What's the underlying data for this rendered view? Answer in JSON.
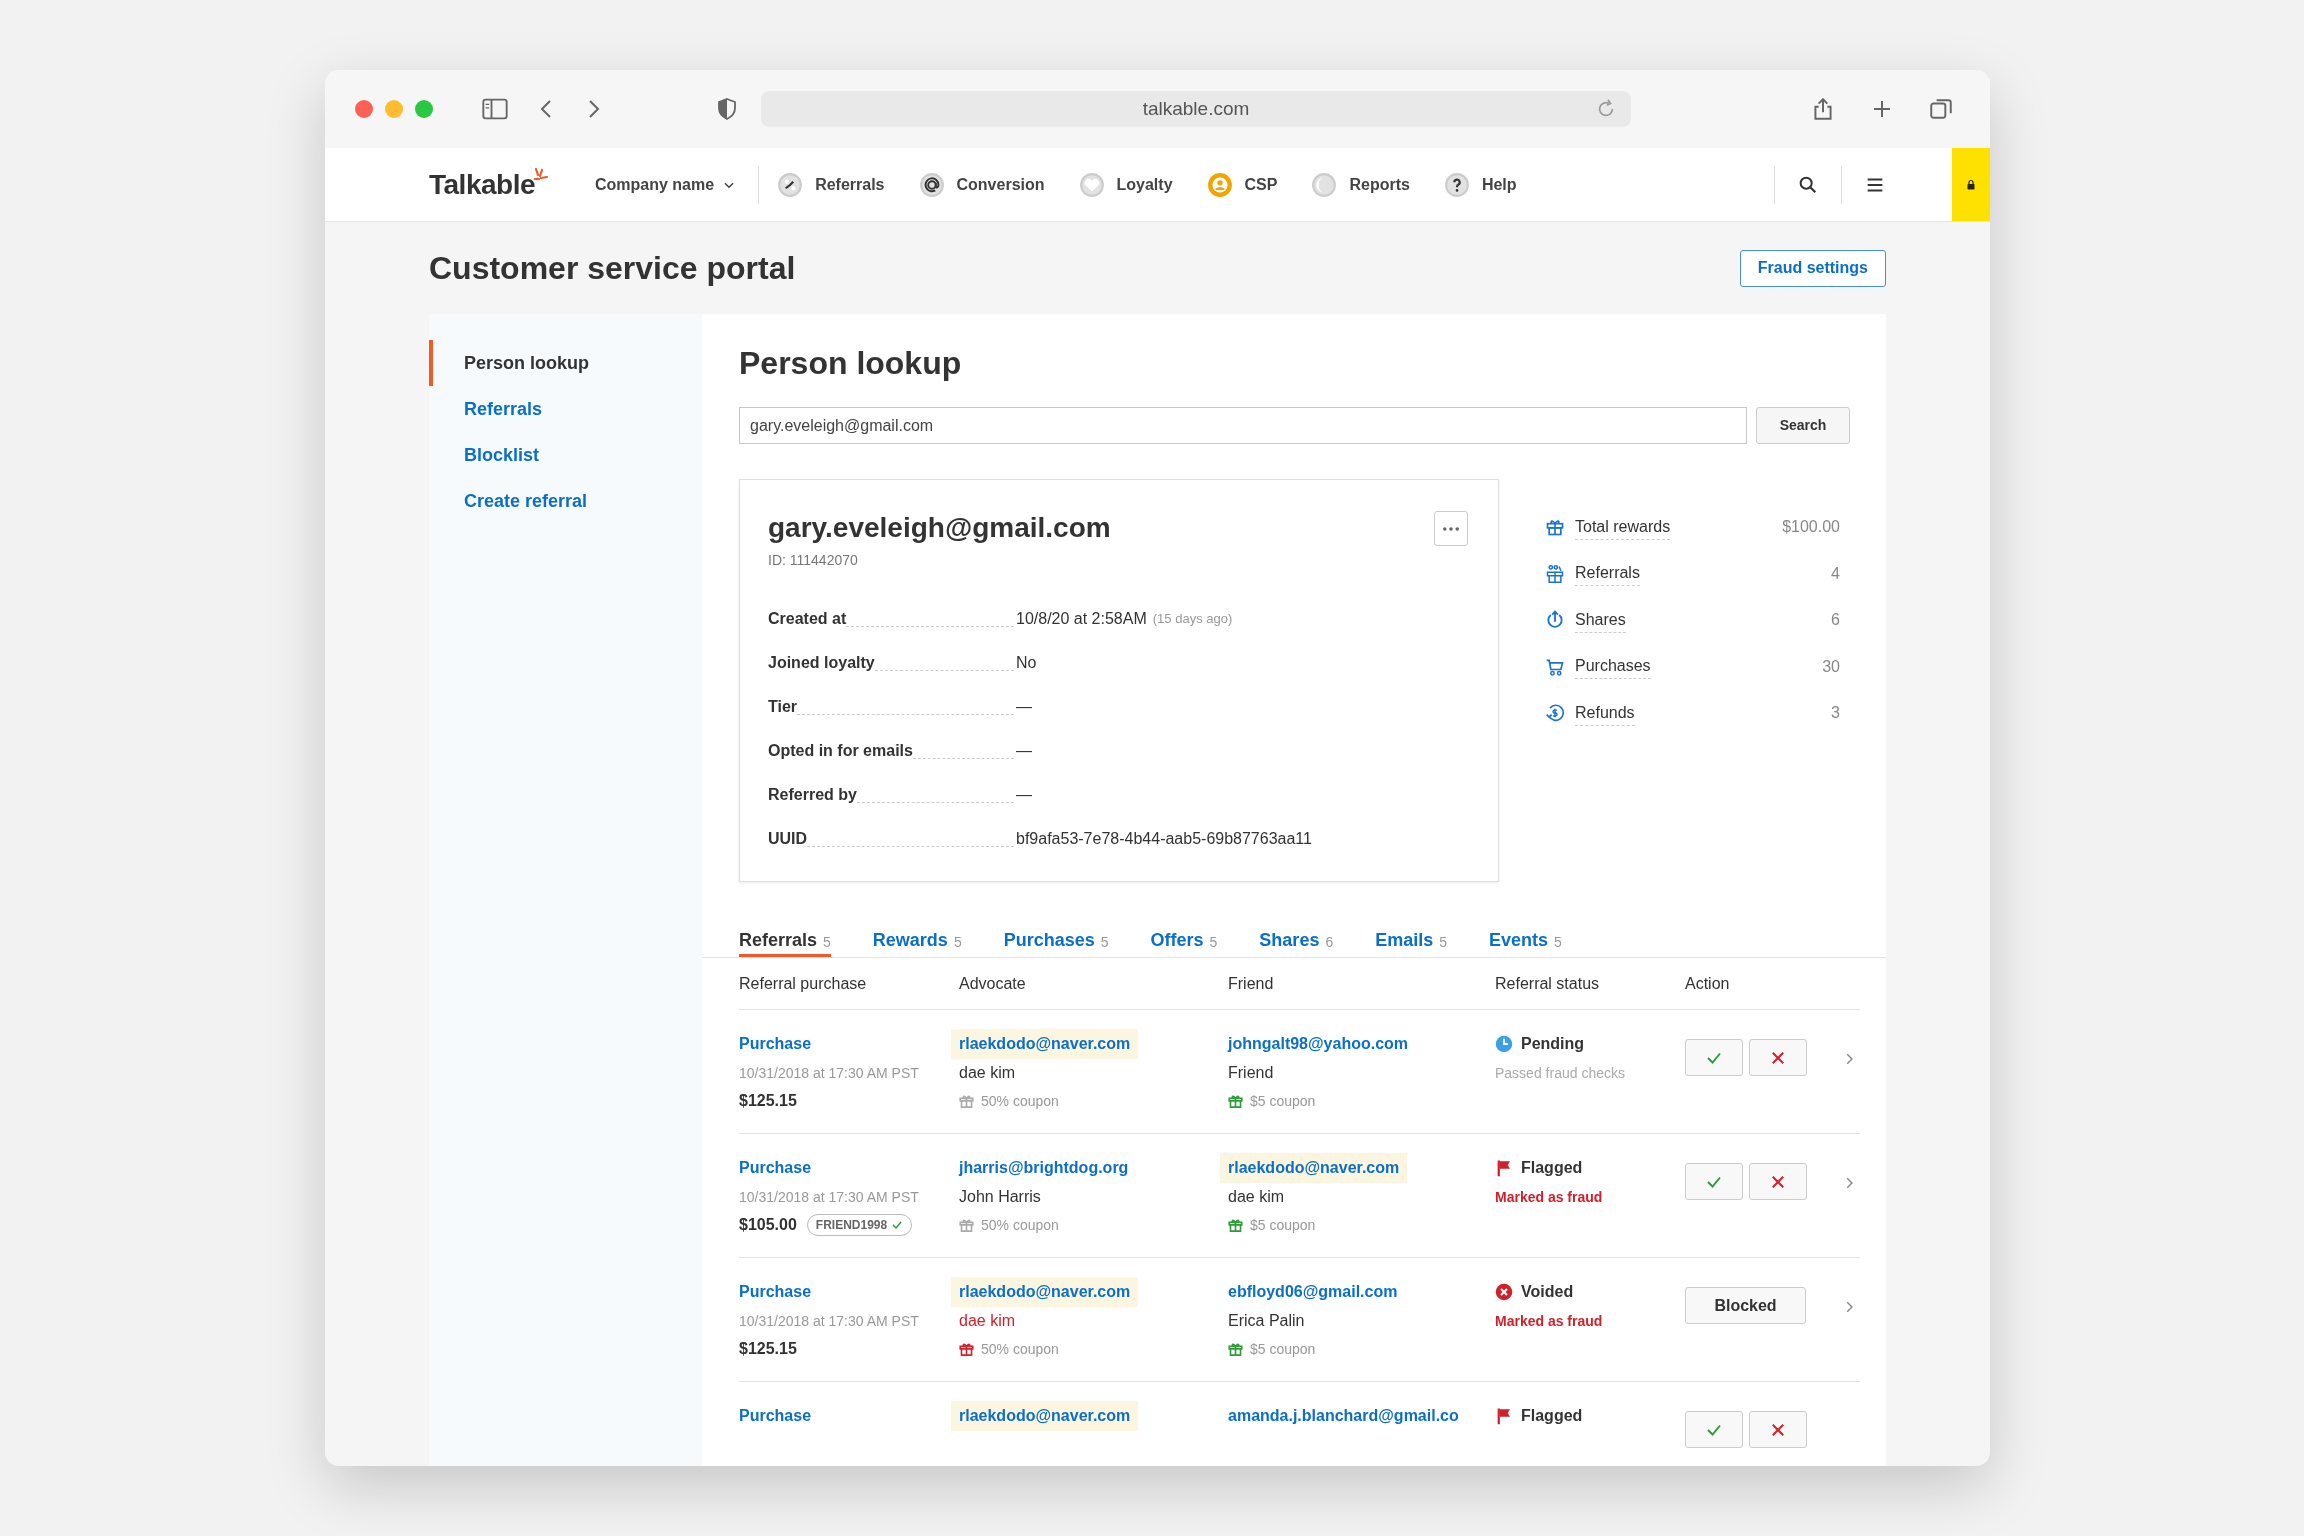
{
  "browser": {
    "url": "talkable.com"
  },
  "nav": {
    "logo": "Talkable",
    "company": "Company name",
    "items": [
      {
        "label": "Referrals",
        "kind": "pinwheel",
        "selected": false
      },
      {
        "label": "Conversion",
        "kind": "at",
        "selected": false
      },
      {
        "label": "Loyalty",
        "kind": "heart",
        "selected": false
      },
      {
        "label": "CSP",
        "kind": "person",
        "selected": true
      },
      {
        "label": "Reports",
        "kind": "moon",
        "selected": false
      },
      {
        "label": "Help",
        "kind": "question",
        "selected": false
      }
    ]
  },
  "page_title": "Customer service portal",
  "fraud_button": "Fraud settings",
  "sidebar": [
    {
      "label": "Person lookup",
      "selected": true
    },
    {
      "label": "Referrals",
      "selected": false
    },
    {
      "label": "Blocklist",
      "selected": false
    },
    {
      "label": "Create referral",
      "selected": false
    }
  ],
  "lookup": {
    "heading": "Person lookup",
    "search_value": "gary.eveleigh@gmail.com",
    "search_button": "Search"
  },
  "profile": {
    "email": "gary.eveleigh@gmail.com",
    "id": "ID: 111442070",
    "fields": [
      {
        "label": "Created at",
        "value": "10/8/20 at 2:58AM",
        "note": "(15 days ago)"
      },
      {
        "label": "Joined loyalty",
        "value": "No"
      },
      {
        "label": "Tier",
        "value": "—"
      },
      {
        "label": "Opted in for emails",
        "value": "—"
      },
      {
        "label": "Referred by",
        "value": "—"
      },
      {
        "label": "UUID",
        "value": "bf9afa53-7e78-4b44-aab5-69b87763aa11"
      }
    ]
  },
  "stats": [
    {
      "label": "Total rewards",
      "value": "$100.00",
      "kind": "gift"
    },
    {
      "label": "Referrals",
      "value": "4",
      "kind": "people"
    },
    {
      "label": "Shares",
      "value": "6",
      "kind": "share"
    },
    {
      "label": "Purchases",
      "value": "30",
      "kind": "cart"
    },
    {
      "label": "Refunds",
      "value": "3",
      "kind": "refund"
    }
  ],
  "tabs": [
    {
      "label": "Referrals",
      "count": "5",
      "selected": true
    },
    {
      "label": "Rewards",
      "count": "5",
      "selected": false
    },
    {
      "label": "Purchases",
      "count": "5",
      "selected": false
    },
    {
      "label": "Offers",
      "count": "5",
      "selected": false
    },
    {
      "label": "Shares",
      "count": "6",
      "selected": false
    },
    {
      "label": "Emails",
      "count": "5",
      "selected": false
    },
    {
      "label": "Events",
      "count": "5",
      "selected": false
    }
  ],
  "table": {
    "columns": [
      "Referral purchase",
      "Advocate",
      "Friend",
      "Referral status",
      "Action"
    ],
    "rows": [
      {
        "purchase": "Purchase",
        "date": "10/31/2018 at 17:30 AM PST",
        "amount": "$125.15",
        "advocate": {
          "email": "rlaekdodo@naver.com",
          "highlighted": true,
          "name": "dae kim",
          "reward": "50% coupon",
          "fraud": false
        },
        "friend": {
          "email": "johngalt98@yahoo.com",
          "highlighted": false,
          "name": "Friend",
          "reward": "$5 coupon"
        },
        "status": {
          "kind": "pending",
          "label": "Pending",
          "note": "Passed fraud checks",
          "alert": false
        },
        "action": {
          "kind": "approve_reject"
        }
      },
      {
        "purchase": "Purchase",
        "date": "10/31/2018 at 17:30 AM PST",
        "amount": "$105.00",
        "promo": {
          "code": "FRIEND1998",
          "verified": true
        },
        "advocate": {
          "email": "jharris@brightdog.org",
          "highlighted": false,
          "name": "John Harris",
          "reward": "50% coupon",
          "fraud": false
        },
        "friend": {
          "email": "rlaekdodo@naver.com",
          "highlighted": true,
          "name": "dae kim",
          "reward": "$5 coupon"
        },
        "status": {
          "kind": "flagged",
          "label": "Flagged",
          "note": "Marked as fraud",
          "alert": true
        },
        "action": {
          "kind": "approve_reject"
        }
      },
      {
        "purchase": "Purchase",
        "date": "10/31/2018 at 17:30 AM PST",
        "amount": "$125.15",
        "advocate": {
          "email": "rlaekdodo@naver.com",
          "highlighted": true,
          "name": "dae kim",
          "reward": "50% coupon",
          "fraud": true
        },
        "friend": {
          "email": "ebfloyd06@gmail.com",
          "highlighted": false,
          "name": "Erica Palin",
          "reward": "$5 coupon"
        },
        "status": {
          "kind": "voided",
          "label": "Voided",
          "note": "Marked as fraud",
          "alert": true
        },
        "action": {
          "kind": "blocked",
          "label": "Blocked"
        }
      },
      {
        "purchase": "Purchase",
        "advocate": {
          "email": "rlaekdodo@naver.com",
          "highlighted": true
        },
        "friend": {
          "email": "amanda.j.blanchard@gmail.co",
          "highlighted": false
        },
        "status": {
          "kind": "flagged",
          "label": "Flagged"
        },
        "action": {
          "kind": "approve_reject"
        }
      }
    ]
  }
}
